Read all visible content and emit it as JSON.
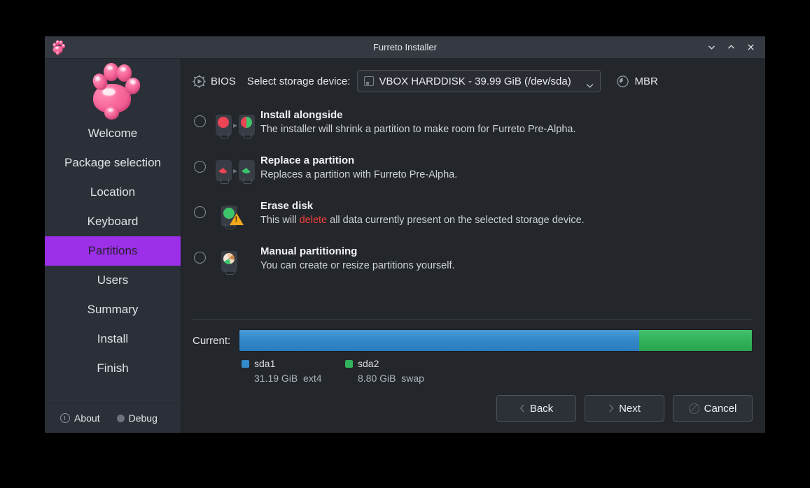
{
  "window": {
    "title": "Furreto Installer",
    "controls": [
      {
        "name": "minimize-button",
        "glyph": "chevron-down"
      },
      {
        "name": "maximize-button",
        "glyph": "chevron-up"
      },
      {
        "name": "close-button",
        "glyph": "close"
      }
    ]
  },
  "sidebar": {
    "logo": "furreto-paw-logo",
    "items": [
      {
        "label": "Welcome",
        "active": false
      },
      {
        "label": "Package selection",
        "active": false
      },
      {
        "label": "Location",
        "active": false
      },
      {
        "label": "Keyboard",
        "active": false
      },
      {
        "label": "Partitions",
        "active": true
      },
      {
        "label": "Users",
        "active": false
      },
      {
        "label": "Summary",
        "active": false
      },
      {
        "label": "Install",
        "active": false
      },
      {
        "label": "Finish",
        "active": false
      }
    ],
    "footer": {
      "about": "About",
      "debug": "Debug"
    },
    "active_color": "#9b30e8"
  },
  "device_row": {
    "firmware": "BIOS",
    "firmware_icon": "gear-play-icon",
    "device_label": "Select storage device:",
    "selected_device": "VBOX HARDDISK - 39.99 GiB (/dev/sda)",
    "partition_table": "MBR",
    "partition_table_icon": "disk-pie-icon"
  },
  "options": [
    {
      "title": "Install alongside",
      "desc_before": "The installer will shrink a partition to make room for Furreto Pre-Alpha.",
      "desc_highlight": "",
      "desc_after": "",
      "selected": false,
      "icon": "disk-shrink-icon"
    },
    {
      "title": "Replace a partition",
      "desc_before": "Replaces a partition with Furreto Pre-Alpha.",
      "desc_highlight": "",
      "desc_after": "",
      "selected": false,
      "icon": "disk-replace-icon"
    },
    {
      "title": "Erase disk",
      "desc_before": "This will ",
      "desc_highlight": "delete",
      "desc_after": " all data currently present on the selected storage device.",
      "selected": false,
      "icon": "disk-erase-warning-icon"
    },
    {
      "title": "Manual partitioning",
      "desc_before": "You can create or resize partitions yourself.",
      "desc_highlight": "",
      "desc_after": "",
      "selected": false,
      "icon": "disk-manual-icon"
    }
  ],
  "partition_preview": {
    "label": "Current:",
    "segments": [
      {
        "name": "sda1",
        "size": "31.19 GiB",
        "fs": "ext4",
        "percent": 78,
        "color": "#3389ca"
      },
      {
        "name": "sda2",
        "size": "8.80 GiB",
        "fs": "swap",
        "percent": 22,
        "color": "#33b35c"
      }
    ]
  },
  "buttons": {
    "back": "Back",
    "next": "Next",
    "cancel": "Cancel"
  },
  "highlight_color": "#f0403a"
}
